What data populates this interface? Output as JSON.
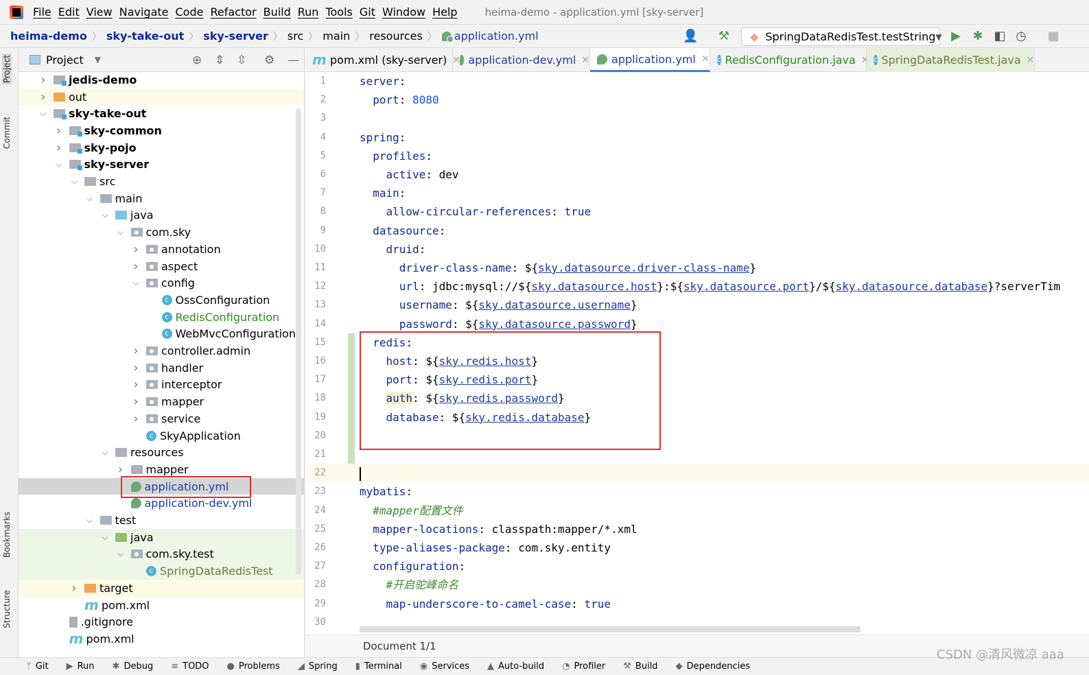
{
  "menubar": {
    "items": [
      "File",
      "Edit",
      "View",
      "Navigate",
      "Code",
      "Refactor",
      "Build",
      "Run",
      "Tools",
      "Git",
      "Window",
      "Help"
    ],
    "title": "heima-demo - application.yml [sky-server]"
  },
  "breadcrumb": [
    {
      "label": "heima-demo",
      "bold": true
    },
    {
      "label": "sky-take-out",
      "bold": true
    },
    {
      "label": "sky-server",
      "bold": true
    },
    {
      "label": "src"
    },
    {
      "label": "main"
    },
    {
      "label": "resources"
    },
    {
      "label": "application.yml",
      "file": true
    }
  ],
  "run_config": "SpringDataRedisTest.testString",
  "left_stripe": [
    "Project",
    "Commit",
    "Bookmarks",
    "Structure"
  ],
  "project_panel": {
    "title": "Project"
  },
  "tree": [
    {
      "label": "jedis-demo",
      "depth": 0,
      "arrow": "right",
      "icon": "module",
      "bold": true
    },
    {
      "label": "out",
      "depth": 0,
      "arrow": "right",
      "icon": "orange",
      "bg": "#fdfbe6"
    },
    {
      "label": "sky-take-out",
      "depth": 0,
      "arrow": "down",
      "icon": "module",
      "bold": true
    },
    {
      "label": "sky-common",
      "depth": 1,
      "arrow": "right",
      "icon": "module",
      "bold": true
    },
    {
      "label": "sky-pojo",
      "depth": 1,
      "arrow": "right",
      "icon": "module",
      "bold": true
    },
    {
      "label": "sky-server",
      "depth": 1,
      "arrow": "down",
      "icon": "module",
      "bold": true
    },
    {
      "label": "src",
      "depth": 2,
      "arrow": "down",
      "icon": "folder"
    },
    {
      "label": "main",
      "depth": 3,
      "arrow": "down",
      "icon": "folder"
    },
    {
      "label": "java",
      "depth": 4,
      "arrow": "down",
      "icon": "blue"
    },
    {
      "label": "com.sky",
      "depth": 5,
      "arrow": "down",
      "icon": "pkg"
    },
    {
      "label": "annotation",
      "depth": 6,
      "arrow": "right",
      "icon": "pkg"
    },
    {
      "label": "aspect",
      "depth": 6,
      "arrow": "right",
      "icon": "pkg"
    },
    {
      "label": "config",
      "depth": 6,
      "arrow": "down",
      "icon": "pkg"
    },
    {
      "label": "OssConfiguration",
      "depth": 7,
      "icon": "cls"
    },
    {
      "label": "RedisConfiguration",
      "depth": 7,
      "icon": "cls",
      "color": "#2f8a1f"
    },
    {
      "label": "WebMvcConfiguration",
      "depth": 7,
      "icon": "cls"
    },
    {
      "label": "controller.admin",
      "depth": 6,
      "arrow": "right",
      "icon": "pkg"
    },
    {
      "label": "handler",
      "depth": 6,
      "arrow": "right",
      "icon": "pkg"
    },
    {
      "label": "interceptor",
      "depth": 6,
      "arrow": "right",
      "icon": "pkg"
    },
    {
      "label": "mapper",
      "depth": 6,
      "arrow": "right",
      "icon": "pkg"
    },
    {
      "label": "service",
      "depth": 6,
      "arrow": "right",
      "icon": "pkg"
    },
    {
      "label": "SkyApplication",
      "depth": 6,
      "icon": "cls"
    },
    {
      "label": "resources",
      "depth": 4,
      "arrow": "down",
      "icon": "folder"
    },
    {
      "label": "mapper",
      "depth": 5,
      "arrow": "right",
      "icon": "folder"
    },
    {
      "label": "application.yml",
      "depth": 5,
      "icon": "yml",
      "color": "#1f3ca6",
      "bg": "#d5d5d5",
      "selected": true
    },
    {
      "label": "application-dev.yml",
      "depth": 5,
      "icon": "yml",
      "color": "#1f3ca6"
    },
    {
      "label": "test",
      "depth": 3,
      "arrow": "down",
      "icon": "folder"
    },
    {
      "label": "java",
      "depth": 4,
      "arrow": "down",
      "icon": "green",
      "bg": "#eef6e6"
    },
    {
      "label": "com.sky.test",
      "depth": 5,
      "arrow": "down",
      "icon": "pkg",
      "bg": "#eef6e6"
    },
    {
      "label": "SpringDataRedisTest",
      "depth": 6,
      "icon": "cls",
      "color": "#6e7b3a",
      "bg": "#eef6e6"
    },
    {
      "label": "target",
      "depth": 2,
      "arrow": "right",
      "icon": "orange",
      "bg": "#fdfbe6"
    },
    {
      "label": "pom.xml",
      "depth": 2,
      "icon": "mvn"
    },
    {
      "label": ".gitignore",
      "depth": 1,
      "icon": "file"
    },
    {
      "label": "pom.xml",
      "depth": 1,
      "icon": "mvn"
    }
  ],
  "tabs": [
    {
      "label": "pom.xml (sky-server)",
      "icon": "mvn",
      "color": "#000"
    },
    {
      "label": "application-dev.yml",
      "icon": "yml",
      "color": "#1f3ca6"
    },
    {
      "label": "application.yml",
      "icon": "yml",
      "color": "#1f3ca6",
      "active": true
    },
    {
      "label": "RedisConfiguration.java",
      "icon": "cls",
      "color": "#2f8a1f"
    },
    {
      "label": "SpringDataRedisTest.java",
      "icon": "cls",
      "color": "#6e7b3a",
      "bg": "#e6efdc"
    }
  ],
  "code": [
    [
      [
        "k",
        "server"
      ],
      [
        "p",
        ":"
      ]
    ],
    [
      [
        "k",
        "  port"
      ],
      [
        "p",
        ": "
      ],
      [
        "n",
        "8080"
      ]
    ],
    [],
    [
      [
        "k",
        "spring"
      ],
      [
        "p",
        ":"
      ]
    ],
    [
      [
        "k",
        "  profiles"
      ],
      [
        "p",
        ":"
      ]
    ],
    [
      [
        "k",
        "    active"
      ],
      [
        "p",
        ": dev"
      ]
    ],
    [
      [
        "k",
        "  main"
      ],
      [
        "p",
        ":"
      ]
    ],
    [
      [
        "k",
        "    allow-circular-references"
      ],
      [
        "p",
        ": "
      ],
      [
        "b",
        "true"
      ]
    ],
    [
      [
        "k",
        "  datasource"
      ],
      [
        "p",
        ":"
      ]
    ],
    [
      [
        "k",
        "    druid"
      ],
      [
        "p",
        ":"
      ]
    ],
    [
      [
        "k",
        "      driver-class-name"
      ],
      [
        "p",
        ": ${"
      ],
      [
        "l",
        "sky.datasource.driver-class-name"
      ],
      [
        "p",
        "}"
      ]
    ],
    [
      [
        "k",
        "      url"
      ],
      [
        "p",
        ": jdbc:mysql://${"
      ],
      [
        "l",
        "sky.datasource.host"
      ],
      [
        "p",
        "}:${"
      ],
      [
        "l",
        "sky.datasource.port"
      ],
      [
        "p",
        "}/${"
      ],
      [
        "l",
        "sky.datasource.database"
      ],
      [
        "p",
        "}?serverTim"
      ]
    ],
    [
      [
        "k",
        "      username"
      ],
      [
        "p",
        ": ${"
      ],
      [
        "l",
        "sky.datasource.username"
      ],
      [
        "p",
        "}"
      ]
    ],
    [
      [
        "k",
        "      password"
      ],
      [
        "p",
        ": ${"
      ],
      [
        "l",
        "sky.datasource.password"
      ],
      [
        "p",
        "}"
      ]
    ],
    [
      [
        "k",
        "  redis"
      ],
      [
        "p",
        ":"
      ]
    ],
    [
      [
        "k",
        "    host"
      ],
      [
        "p",
        ": ${"
      ],
      [
        "l",
        "sky.redis.host"
      ],
      [
        "p",
        "}"
      ]
    ],
    [
      [
        "k",
        "    port"
      ],
      [
        "p",
        ": ${"
      ],
      [
        "l",
        "sky.redis.port"
      ],
      [
        "p",
        "}"
      ]
    ],
    [
      [
        "k",
        "    "
      ],
      [
        "k hl",
        "auth"
      ],
      [
        "p",
        ": ${"
      ],
      [
        "l",
        "sky.redis.password"
      ],
      [
        "p",
        "}"
      ]
    ],
    [
      [
        "k",
        "    database"
      ],
      [
        "p",
        ": ${"
      ],
      [
        "l",
        "sky.redis.database"
      ],
      [
        "p",
        "}"
      ]
    ],
    [],
    [],
    [],
    [
      [
        "k",
        "mybatis"
      ],
      [
        "p",
        ":"
      ]
    ],
    [
      [
        "c",
        "  #mapper配置文件"
      ]
    ],
    [
      [
        "k",
        "  mapper-locations"
      ],
      [
        "p",
        ": classpath:mapper/*.xml"
      ]
    ],
    [
      [
        "k",
        "  type-aliases-package"
      ],
      [
        "p",
        ": com.sky.entity"
      ]
    ],
    [
      [
        "k",
        "  configuration"
      ],
      [
        "p",
        ":"
      ]
    ],
    [
      [
        "c",
        "    #开启驼峰命名"
      ]
    ],
    [
      [
        "k",
        "    map-underscore-to-camel-case"
      ],
      [
        "p",
        ": "
      ],
      [
        "b",
        "true"
      ]
    ],
    []
  ],
  "editor": {
    "current_line": 22,
    "changed_lines": [
      15,
      21
    ]
  },
  "status": {
    "text": "Document 1/1"
  },
  "bottom_tools": [
    {
      "label": "Git",
      "icon": "ᛘ"
    },
    {
      "label": "Run",
      "icon": "▶"
    },
    {
      "label": "Debug",
      "icon": "✱"
    },
    {
      "label": "TODO",
      "icon": "≡"
    },
    {
      "label": "Problems",
      "icon": "●"
    },
    {
      "label": "Spring",
      "icon": "◢"
    },
    {
      "label": "Terminal",
      "icon": "▮"
    },
    {
      "label": "Services",
      "icon": "◉"
    },
    {
      "label": "Auto-build",
      "icon": "▲"
    },
    {
      "label": "Profiler",
      "icon": "◔"
    },
    {
      "label": "Build",
      "icon": "⚒"
    },
    {
      "label": "Dependencies",
      "icon": "◆"
    }
  ],
  "watermark": "CSDN @清风微凉 aaa"
}
